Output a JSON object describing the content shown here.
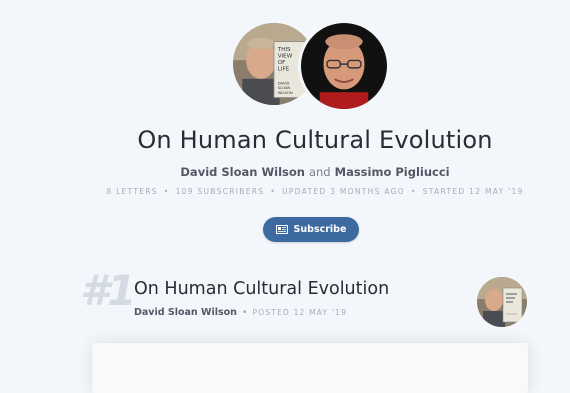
{
  "newsletter": {
    "title": "On Human Cultural Evolution",
    "author1": "David Sloan Wilson",
    "and_text": "and",
    "author2": "Massimo Pigliucci",
    "stats": {
      "letters": "8 LETTERS",
      "subscribers": "109 SUBSCRIBERS",
      "updated": "UPDATED 3 MONTHS AGO",
      "started": "STARTED 12 MAY '19"
    },
    "subscribe_label": "Subscribe"
  },
  "letter": {
    "number": "#1",
    "title": "On Human Cultural Evolution",
    "author": "David Sloan Wilson",
    "posted": "POSTED 12 MAY '19"
  },
  "book_cover_text": [
    "THIS",
    "VIEW",
    "OF",
    "LIFE",
    "DAVID",
    "SLOAN",
    "WILSON"
  ],
  "colors": {
    "background": "#f3f6fa",
    "accent": "#3d6ba1",
    "muted": "#a6adb9"
  }
}
